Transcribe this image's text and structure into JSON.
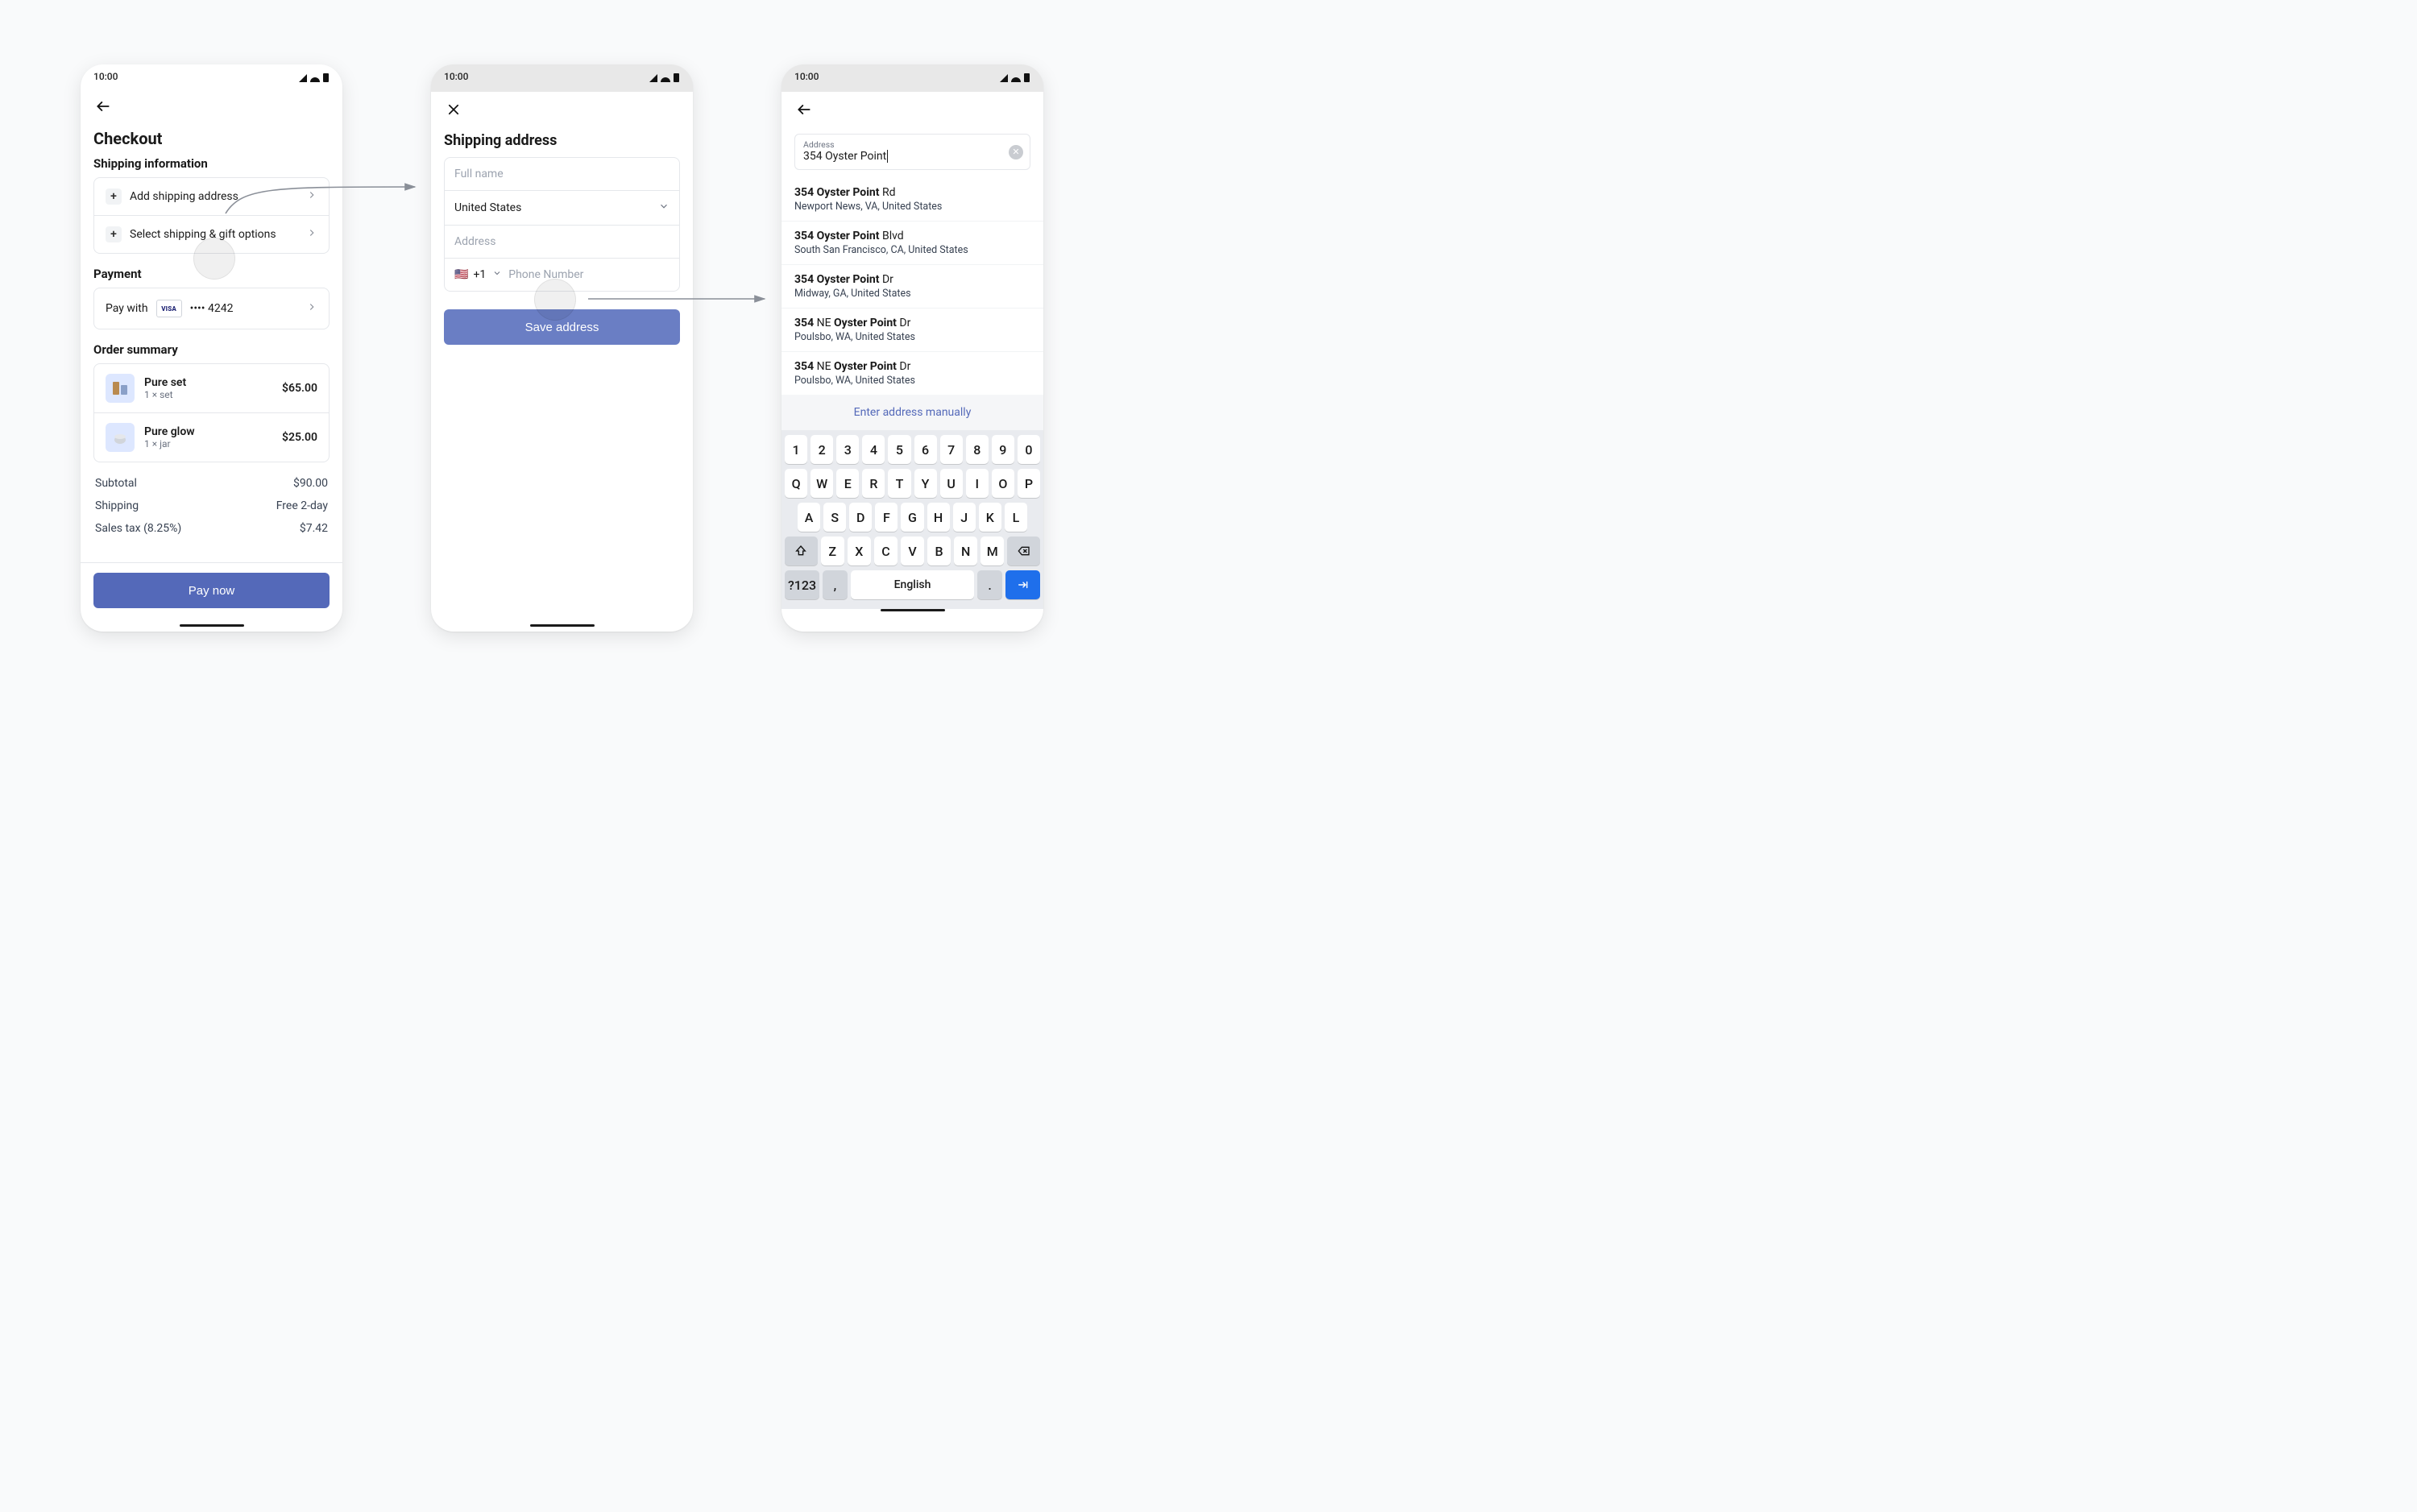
{
  "status": {
    "time": "10:00"
  },
  "screen1": {
    "title": "Checkout",
    "sections": {
      "shipping": {
        "title": "Shipping information",
        "add_address": "Add shipping address",
        "select_options": "Select shipping & gift options"
      },
      "payment": {
        "title": "Payment",
        "pay_with": "Pay with",
        "brand": "VISA",
        "last4": "•••• 4242"
      },
      "order": {
        "title": "Order summary",
        "items": [
          {
            "name": "Pure set",
            "meta": "1 × set",
            "price": "$65.00"
          },
          {
            "name": "Pure glow",
            "meta": "1 × jar",
            "price": "$25.00"
          }
        ]
      }
    },
    "totals": {
      "subtotal_label": "Subtotal",
      "subtotal_value": "$90.00",
      "shipping_label": "Shipping",
      "shipping_value": "Free 2-day",
      "tax_label": "Sales tax (8.25%)",
      "tax_value": "$7.42"
    },
    "cta": "Pay now"
  },
  "screen2": {
    "title": "Shipping address",
    "full_name_ph": "Full name",
    "country": "United States",
    "address_ph": "Address",
    "phone_prefix": "+1",
    "phone_ph": "Phone Number",
    "cta": "Save address"
  },
  "screen3": {
    "field_label": "Address",
    "query": "354 Oyster Point",
    "manual": "Enter address manually",
    "suggestions": [
      {
        "prefix": "",
        "bold": "354 Oyster Point",
        "suffix": " Rd",
        "sub": "Newport News, VA, United States"
      },
      {
        "prefix": "",
        "bold": "354 Oyster Point",
        "suffix": " Blvd",
        "sub": "South San Francisco, CA, United States"
      },
      {
        "prefix": "",
        "bold": "354 Oyster Point",
        "suffix": " Dr",
        "sub": "Midway, GA, United States"
      },
      {
        "prefix": " NE ",
        "bold_pre": "354",
        "bold": "Oyster Point",
        "suffix": " Dr",
        "sub": "Poulsbo, WA, United States"
      },
      {
        "prefix": " NE ",
        "bold_pre": "354",
        "bold": "Oyster Point",
        "suffix": " Dr",
        "sub": "Poulsbo, WA, United States"
      }
    ],
    "keyboard": {
      "rows": [
        [
          "1",
          "2",
          "3",
          "4",
          "5",
          "6",
          "7",
          "8",
          "9",
          "0"
        ],
        [
          "Q",
          "W",
          "E",
          "R",
          "T",
          "Y",
          "U",
          "I",
          "O",
          "P"
        ],
        [
          "A",
          "S",
          "D",
          "F",
          "G",
          "H",
          "J",
          "K",
          "L"
        ],
        [
          "Z",
          "X",
          "C",
          "V",
          "B",
          "N",
          "M"
        ]
      ],
      "mode": "?123",
      "comma": ",",
      "space": "English",
      "period": ".",
      "enter": "→|"
    }
  }
}
